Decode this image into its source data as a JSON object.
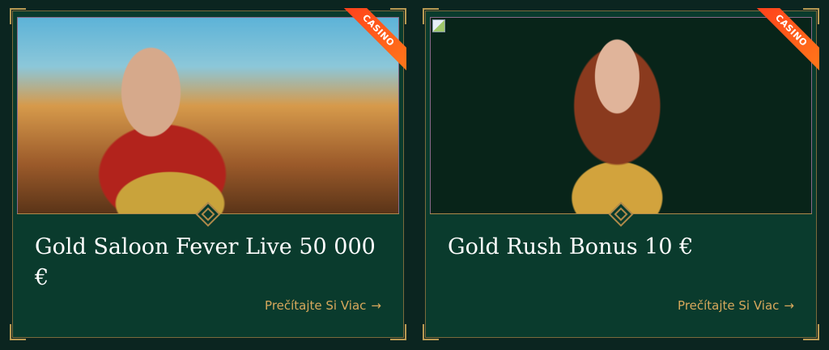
{
  "colors": {
    "page_bg": "#0b2520",
    "card_bg": "#0a3b2d",
    "gold_border": "#b08a4a",
    "link": "#d7a85c",
    "ribbon": "#ff4a1c"
  },
  "cards": [
    {
      "badge": "CASINO",
      "title": "Gold Saloon Fever Live 50 000 €",
      "link_label": "Prečítajte Si Viac",
      "link_icon": "→",
      "image": "promo-art-queen-castle"
    },
    {
      "badge": "CASINO",
      "title": "Gold Rush Bonus 10 €",
      "link_label": "Prečítajte Si Viac",
      "link_icon": "→",
      "image": "promo-art-warrior-woman",
      "image_broken": true
    }
  ]
}
